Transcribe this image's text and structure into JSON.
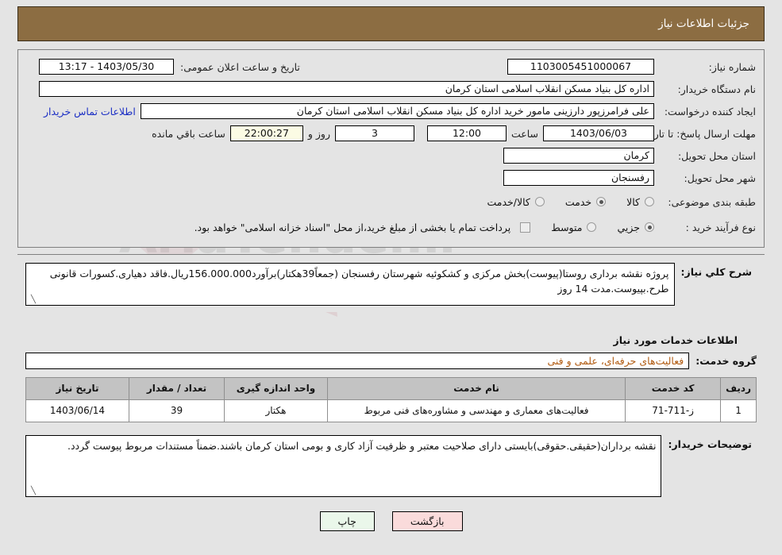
{
  "header": {
    "title": "جزئیات اطلاعات نیاز",
    "bg_color": "#8c6d42",
    "text_color": "#ffffff"
  },
  "form": {
    "need_number_label": "شماره نیاز:",
    "need_number_value": "1103005451000067",
    "announce_label": "تاریخ و ساعت اعلان عمومی:",
    "announce_value": "1403/05/30 - 13:17",
    "buyer_org_label": "نام دستگاه خریدار:",
    "buyer_org_value": "اداره کل بنیاد مسکن انقلاب اسلامی استان کرمان",
    "creator_label": "ایجاد کننده درخواست:",
    "creator_value": "علی فرامرزپور دارزینی مامور خرید اداره کل بنیاد مسکن انقلاب اسلامی استان کرمان",
    "contact_link": "اطلاعات تماس خریدار",
    "deadline_label": "مهلت ارسال پاسخ: تا تاریخ:",
    "deadline_date": "1403/06/03",
    "deadline_hour_label": "ساعت",
    "deadline_hour": "12:00",
    "remaining_days": "3",
    "remaining_days_label": "روز و",
    "remaining_clock": "22:00:27",
    "remaining_clock_label": "ساعت باقي مانده",
    "province_label": "استان محل تحویل:",
    "province_value": "کرمان",
    "city_label": "شهر محل تحویل:",
    "city_value": "رفسنجان",
    "category_label": "طبقه بندی موضوعی:",
    "category_options": [
      {
        "label": "کالا",
        "selected": false
      },
      {
        "label": "خدمت",
        "selected": true
      },
      {
        "label": "کالا/خدمت",
        "selected": false
      }
    ],
    "process_label": "نوع فرآیند خرید :",
    "process_options": [
      {
        "label": "جزیي",
        "selected": true
      },
      {
        "label": "متوسط",
        "selected": false
      }
    ],
    "treasury_checkbox_text": "پرداخت تمام یا بخشی از مبلغ خرید،از محل \"اسناد خزانه اسلامی\" خواهد بود.",
    "treasury_checked": false
  },
  "summary": {
    "label": "شرح کلي نیاز:",
    "text": "پروژه نقشه برداری روستا(پیوست)بخش مرکزی و کشکوئیه شهرستان رفسنجان (جمعاً39هکتار)برآورد156.000.000ریال.فاقد دهیاری.کسورات قانونی طرح.بپیوست.مدت 14 روز"
  },
  "services_section": {
    "heading": "اطلاعات خدمات مورد نیاز",
    "group_label": "گروه خدمت:",
    "group_value": "فعالیت‌های حرفه‌ای، علمی و فنی"
  },
  "table": {
    "columns": [
      "ردیف",
      "کد خدمت",
      "نام خدمت",
      "واحد اندازه گیری",
      "تعداد / مقدار",
      "تاریخ نیاز"
    ],
    "rows": [
      {
        "row": "1",
        "code": "ز-711-71",
        "name": "فعالیت‌های معماری و مهندسی و مشاوره‌های فنی مربوط",
        "unit": "هکتار",
        "quantity": "39",
        "need_date": "1403/06/14"
      }
    ]
  },
  "buyer_notes": {
    "label": "توضیحات خریدار:",
    "text": "نقشه برداران(حقیقی.حقوقی)بایستی دارای صلاحیت معتبر و ظرفیت آزاد کاری و بومی استان کرمان باشند.ضمناً مستندات مربوط پیوست گردد."
  },
  "buttons": {
    "print": "چاپ",
    "back": "بازگشت",
    "print_bg": "#eaf7ea",
    "back_bg": "#fadbdb"
  },
  "watermark": {
    "text": "AriaTender.ir",
    "letter": "V"
  }
}
